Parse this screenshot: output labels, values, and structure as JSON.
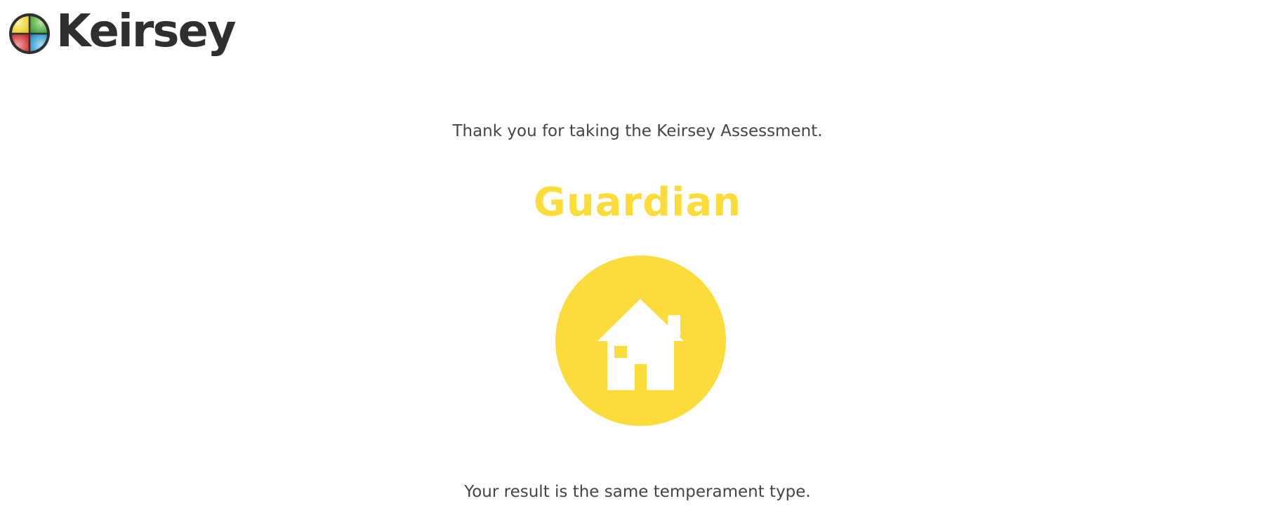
{
  "header": {
    "logo_text": "Keirsey",
    "logo_icon": "keirsey-temperament-wheel-logo"
  },
  "main": {
    "thanks_message": "Thank you for taking the Keirsey Assessment.",
    "result_title": "Guardian",
    "result_icon": "house-icon",
    "result_note": "Your result is the same temperament type."
  },
  "colors": {
    "accent": "#fcdc3b",
    "text": "#444444",
    "logo_text": "#2f2f2f",
    "logo_quadrants": [
      "#f2e23a",
      "#5db34f",
      "#d93b3b",
      "#3ba6d9"
    ]
  }
}
